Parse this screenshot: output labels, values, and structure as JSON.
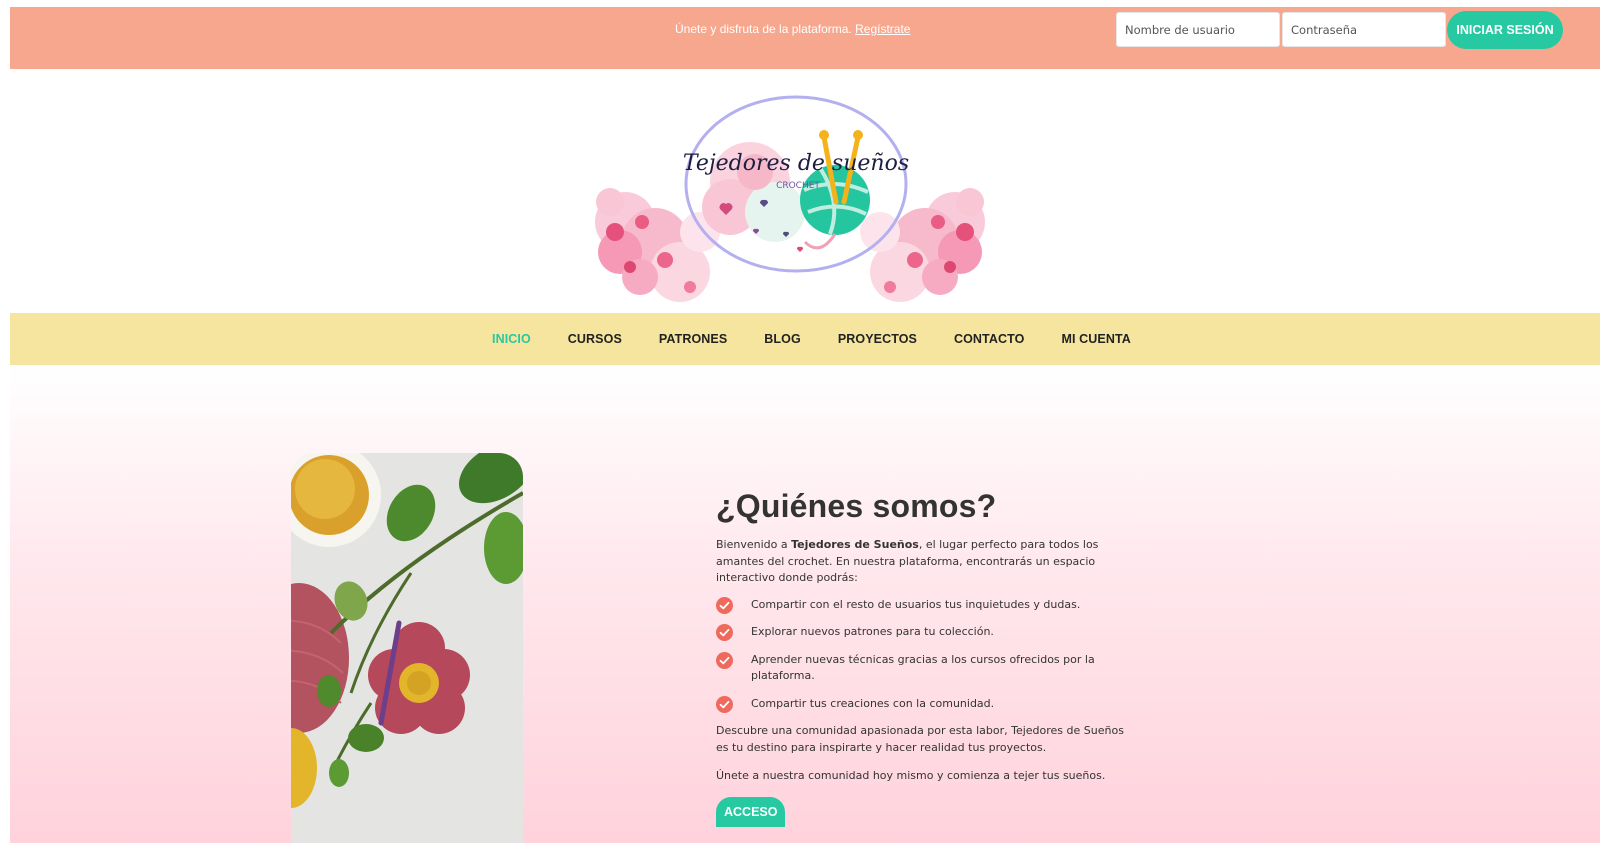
{
  "topbar": {
    "promo_text": "Únete y disfruta de la plataforma.",
    "register_link": "Regístrate",
    "username_placeholder": "Nombre de usuario",
    "password_placeholder": "Contraseña",
    "login_button": "INICIAR SESIÓN"
  },
  "logo": {
    "title": "Tejedores de sueños",
    "subtitle": "CROCHET"
  },
  "nav": {
    "items": [
      "INICIO",
      "CURSOS",
      "PATRONES",
      "BLOG",
      "PROYECTOS",
      "CONTACTO",
      "MI CUENTA"
    ],
    "active": "INICIO"
  },
  "about": {
    "heading": "¿Quiénes somos?",
    "intro_before": "Bienvenido a ",
    "intro_brand": "Tejedores de Sueños",
    "intro_after": ", el lugar perfecto para todos los amantes del crochet. En nuestra plataforma, encontrarás un espacio interactivo donde podrás:",
    "features": [
      "Compartir con el resto de usuarios tus inquietudes y dudas.",
      "Explorar nuevos patrones para tu colección.",
      "Aprender nuevas técnicas gracias a los cursos ofrecidos por la plataforma.",
      "Compartir tus creaciones con la comunidad."
    ],
    "paragraph_2": "Descubre una comunidad apasionada por esta labor, Tejedores de Sueños es tu destino para inspirarte y hacer realidad tus proyectos.",
    "paragraph_3": "Únete a nuestra comunidad hoy mismo y comienza a tejer tus sueños.",
    "access_button": "ACCESO"
  },
  "colors": {
    "topbar": "#f7a78e",
    "accent": "#26c9a1",
    "nav": "#f6e59e",
    "check": "#ef6a5c",
    "hero_bottom": "#ffd2dc"
  },
  "icons": {
    "feature_bullet": "check-circle-icon"
  }
}
